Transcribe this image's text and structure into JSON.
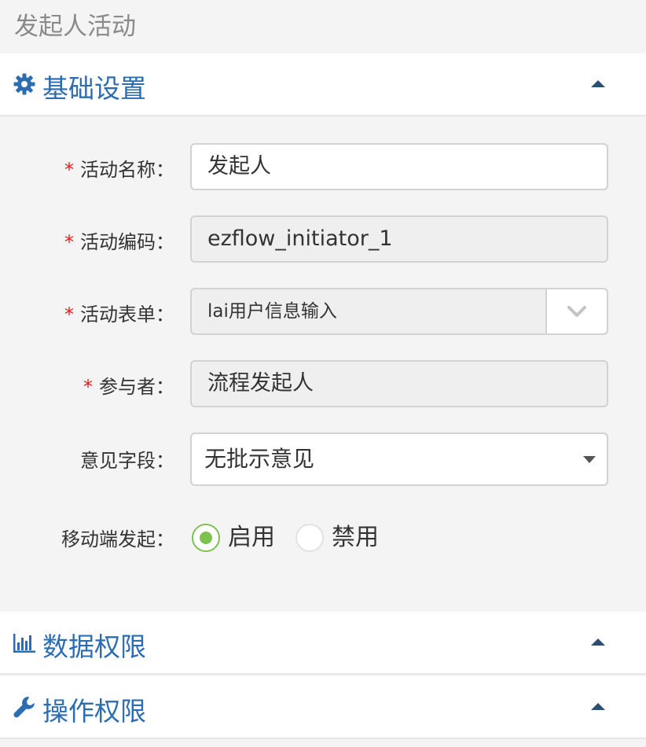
{
  "page_title": "发起人活动",
  "sections": {
    "basic": {
      "title": "基础设置",
      "icon": "gear-icon"
    },
    "data": {
      "title": "数据权限",
      "icon": "bar-chart-icon"
    },
    "operation": {
      "title": "操作权限",
      "icon": "wrench-icon"
    }
  },
  "form": {
    "activity_name": {
      "required_mark": "*",
      "label": "活动名称：",
      "value": "发起人"
    },
    "activity_code": {
      "required_mark": "*",
      "label": "活动编码：",
      "value": "ezflow_initiator_1"
    },
    "activity_form": {
      "required_mark": "*",
      "label": "活动表单：",
      "value": "lai用户信息输入"
    },
    "participant": {
      "required_mark": "*",
      "label": "参与者：",
      "value": "流程发起人"
    },
    "opinion_field": {
      "label": "意见字段：",
      "value": "无批示意见"
    },
    "mobile_initiate": {
      "label": "移动端发起：",
      "options": [
        "启用",
        "禁用"
      ],
      "selected": "启用"
    }
  },
  "colors": {
    "accent": "#2c6db2",
    "required": "#e02020",
    "radio_on": "#7cc24f"
  }
}
